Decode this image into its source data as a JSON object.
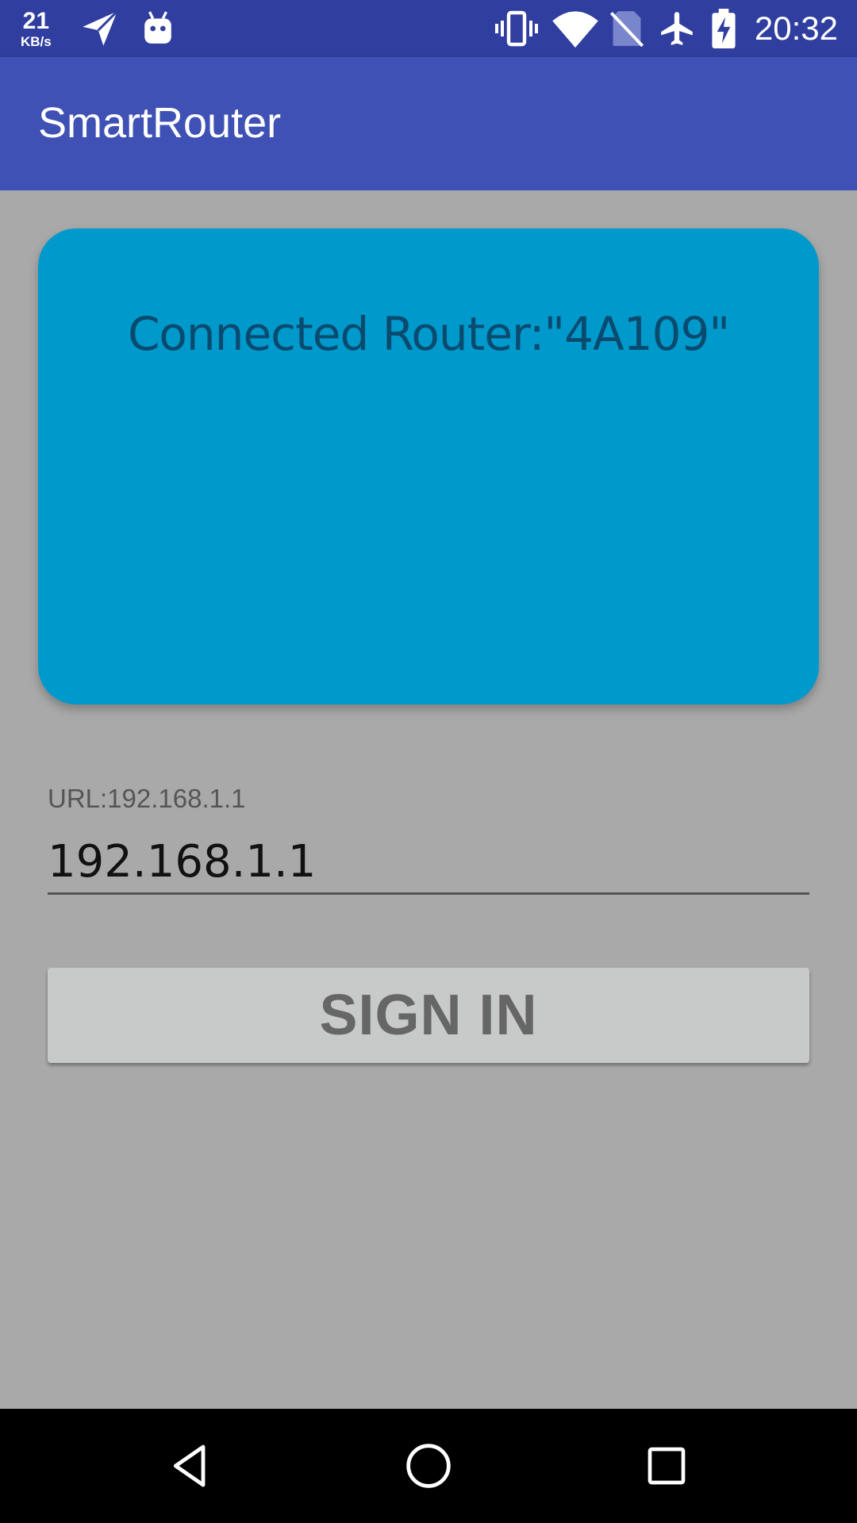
{
  "status_bar": {
    "net_speed_value": "21",
    "net_speed_unit": "KB/s",
    "time": "20:32",
    "left_icons": [
      "send-icon",
      "android-icon"
    ],
    "right_icons": [
      "vibrate-icon",
      "wifi-icon",
      "no-sim-icon",
      "airplane-icon",
      "battery-charging-icon"
    ]
  },
  "app_bar": {
    "title": "SmartRouter",
    "color": "#3f51b5"
  },
  "router_card": {
    "text": "Connected Router:\"4A109\"",
    "color": "#0099cc"
  },
  "url_field": {
    "label": "URL:192.168.1.1",
    "value": "192.168.1.1"
  },
  "sign_in": {
    "label": "SIGN IN"
  },
  "nav_bar": {
    "icons": [
      "back-icon",
      "home-icon",
      "recents-icon"
    ]
  }
}
